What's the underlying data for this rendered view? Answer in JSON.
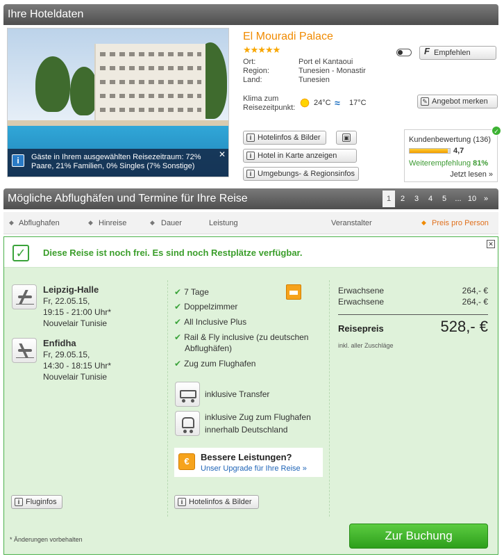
{
  "header": {
    "title": "Ihre Hoteldaten"
  },
  "hotel": {
    "name": "El Mouradi Palace",
    "stars": "★★★★★",
    "photo_note": "Gäste in Ihrem ausgewählten Reisezeitraum: 72% Paare, 21% Familien, 0% Singles (7% Sonstige)",
    "details": [
      {
        "label": "Ort:",
        "value": "Port el Kantaoui"
      },
      {
        "label": "Region:",
        "value": "Tunesien - Monastir"
      },
      {
        "label": "Land:",
        "value": "Tunesien"
      }
    ],
    "climate_label": "Klima zum Reisezeitpunkt:",
    "air_temp": "24°C",
    "water_temp": "17°C"
  },
  "actions": {
    "recommend": "Empfehlen",
    "bookmark": "Angebot merken",
    "hotel_info": "Hotelinfos & Bilder",
    "map": "Hotel in Karte anzeigen",
    "region": "Umgebungs- & Regionsinfos"
  },
  "rating": {
    "title": "Kundenbewertung (136)",
    "score": "4,7",
    "score_fraction": 0.94,
    "recommend_label": "Weiterempfehlung",
    "recommend_value": "81%",
    "read_more": "Jetzt lesen »"
  },
  "section2": {
    "title": "Mögliche Abflughäfen und Termine für Ihre Reise",
    "pages": [
      "1",
      "2",
      "3",
      "4",
      "5",
      "...",
      "10",
      "»"
    ]
  },
  "sortbar": {
    "departure": "Abflughafen",
    "outbound": "Hinreise",
    "duration": "Dauer",
    "service": "Leistung",
    "operator": "Veranstalter",
    "price": "Preis pro Person"
  },
  "offer": {
    "availability": "Diese Reise ist noch frei. Es sind noch Restplätze verfügbar.",
    "outbound": {
      "airport": "Leipzig-Halle",
      "date": "Fr, 22.05.15,",
      "time": "19:15 - 21:00 Uhr*",
      "airline": "Nouvelair Tunisie"
    },
    "return": {
      "airport": "Enfidha",
      "date": "Fr, 29.05.15,",
      "time": "14:30 - 18:15 Uhr*",
      "airline": "Nouvelair Tunisie"
    },
    "features": [
      "7 Tage",
      "Doppelzimmer",
      "All Inclusive Plus",
      "Rail & Fly inclusive (zu deutschen",
      "Abflughäfen)",
      "Zug zum Flughafen"
    ],
    "transfer": "inklusive Transfer",
    "train_line1": "inklusive Zug zum Flughafen",
    "train_line2": "innerhalb Deutschland",
    "upgrade_title": "Bessere Leistungen?",
    "upgrade_link": "Unser Upgrade für Ihre Reise »",
    "flight_info": "Fluginfos",
    "hotel_info": "Hotelinfos & Bilder",
    "prices": [
      {
        "label": "Erwachsene",
        "value": "264,- €"
      },
      {
        "label": "Erwachsene",
        "value": "264,- €"
      }
    ],
    "total_label": "Reisepreis",
    "total": "528,- €",
    "included": "inkl. aller Zuschläge",
    "note": "* Änderungen vorbehalten",
    "book": "Zur Buchung"
  },
  "colors": {
    "accent_orange": "#f08a00",
    "success_green": "#3b9e2b",
    "panel_bg": "#dff2da",
    "header_gray": "#5f5f5f"
  }
}
